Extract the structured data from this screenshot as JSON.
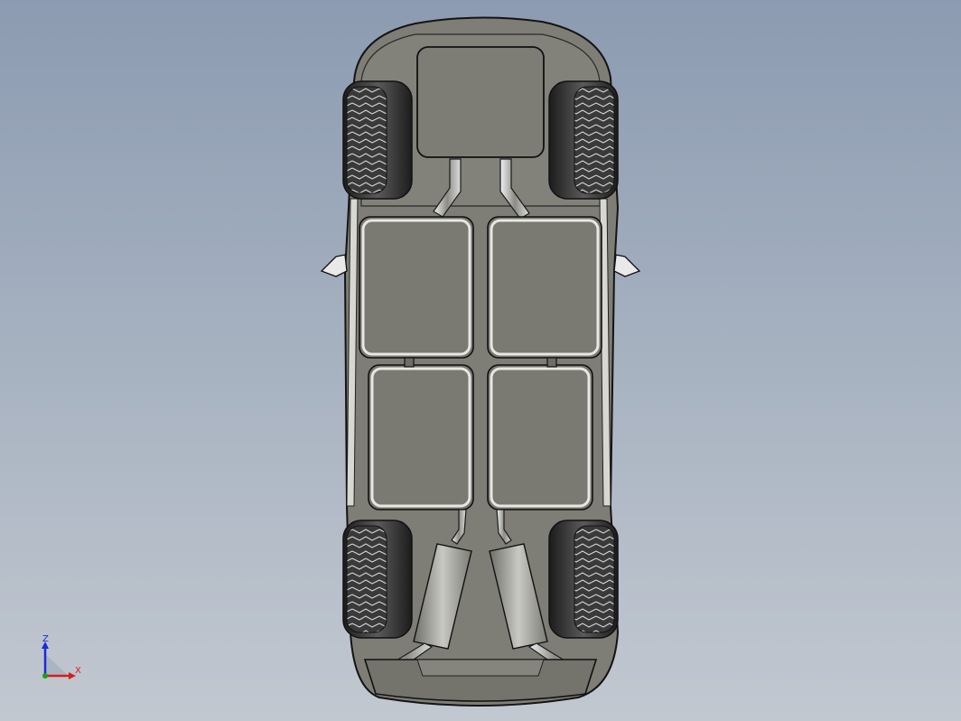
{
  "viewer": {
    "model": "car-underside-bottom-view"
  },
  "triad": {
    "z_label": "Z",
    "x_label": "X",
    "z_color": "#1b2bd6",
    "x_color": "#d91c1c",
    "y_color": "#18a018"
  },
  "colors": {
    "floor": "#807f77",
    "panel": "#7b7a72",
    "outline": "#1a1a1a",
    "tire_dark": "#2b2b2b",
    "tread": "#d8d8d8",
    "exhaust": "#a7a7a0",
    "mirror": "#e6e6e6"
  }
}
